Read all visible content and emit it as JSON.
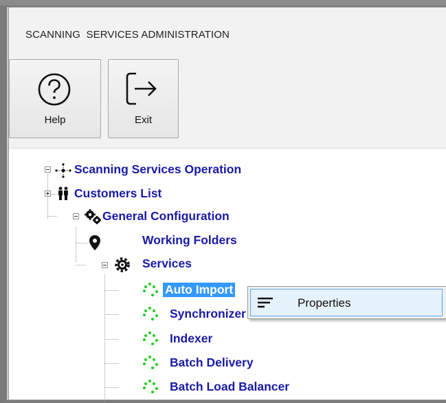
{
  "window": {
    "title": "SCANNING  SERVICES ADMINISTRATION"
  },
  "toolbar": {
    "help_label": "Help",
    "help_icon": "question-circle-icon",
    "exit_label": "Exit",
    "exit_icon": "exit-arrow-icon"
  },
  "tree": {
    "root": {
      "label": "Scanning Services Operation",
      "icon": "network-hub-icon",
      "expanded": true
    },
    "customers": {
      "label": "Customers List",
      "icon": "people-icon",
      "expanded": false
    },
    "general": {
      "label": "General Configuration",
      "icon": "gears-icon",
      "expanded": true
    },
    "working_folders": {
      "label": "Working Folders",
      "icon": "map-pin-icon"
    },
    "services": {
      "label": "Services",
      "icon": "gear-icon",
      "expanded": true
    },
    "service_items": [
      {
        "label": "Auto Import",
        "icon": "green-dots-icon",
        "selected": true
      },
      {
        "label": "Synchronizer",
        "icon": "green-dots-icon"
      },
      {
        "label": "Indexer",
        "icon": "green-dots-icon"
      },
      {
        "label": "Batch Delivery",
        "icon": "green-dots-icon"
      },
      {
        "label": "Batch Load Balancer",
        "icon": "green-dots-icon"
      }
    ]
  },
  "context_menu": {
    "items": [
      {
        "label": "Properties",
        "icon": "properties-lines-icon"
      }
    ]
  },
  "colors": {
    "tree_text": "#1a1aa6",
    "selection": "#3399ff",
    "service_icon": "#22cc22"
  }
}
